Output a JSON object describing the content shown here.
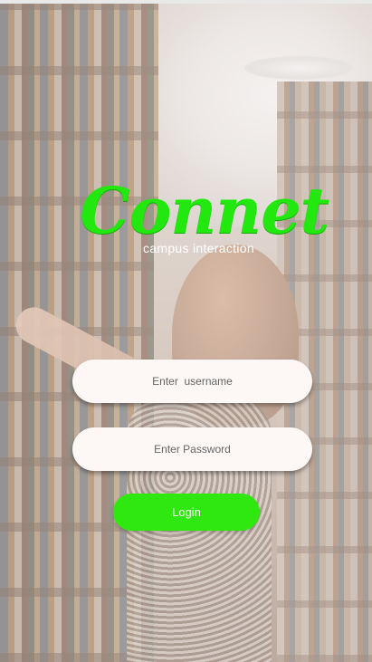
{
  "app": {
    "name": "Connet",
    "tagline": "campus interaction"
  },
  "form": {
    "username": {
      "value": "",
      "placeholder": "Enter  username"
    },
    "password": {
      "value": "",
      "placeholder": "Enter Password"
    },
    "login_label": "Login"
  },
  "colors": {
    "brand_green": "#22e80f",
    "button_green": "#2fe80f",
    "field_background": "#fdf7f6",
    "tagline_text": "#ffffff"
  },
  "background": {
    "description_icon": "library-photo"
  }
}
